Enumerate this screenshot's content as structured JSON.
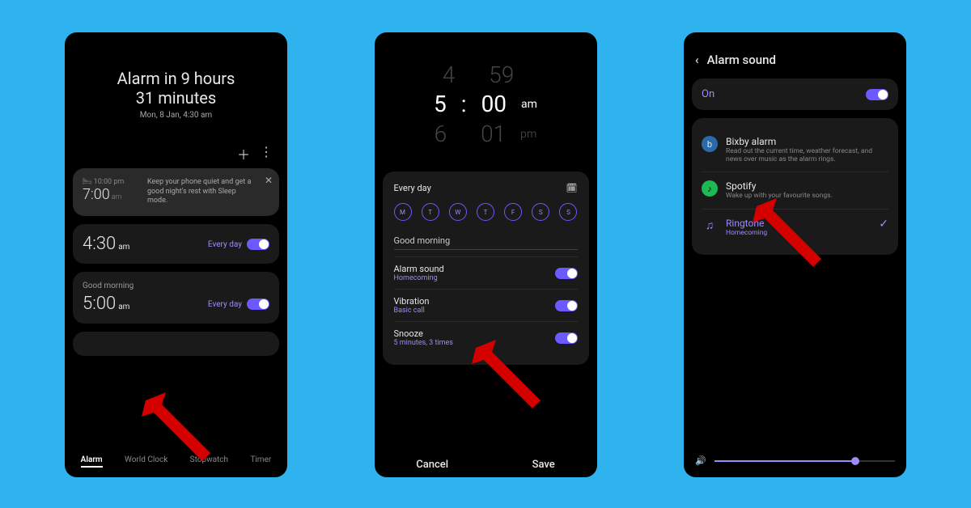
{
  "phone1": {
    "hero_line1": "Alarm in 9 hours",
    "hero_line2": "31 minutes",
    "hero_sub": "Mon, 8 Jan, 4:30 am",
    "sleep": {
      "bedtime": "10:00 pm",
      "wake_time": "7:00",
      "wake_suffix": "am",
      "tip": "Keep your phone quiet and get a good night's rest with Sleep mode."
    },
    "alarm_a": {
      "time": "4:30",
      "suffix": "am",
      "repeat": "Every day"
    },
    "alarm_b": {
      "name": "Good morning",
      "time": "5:00",
      "suffix": "am",
      "repeat": "Every day"
    },
    "tabs": {
      "alarm": "Alarm",
      "world": "World Clock",
      "stop": "Stopwatch",
      "timer": "Timer"
    }
  },
  "phone2": {
    "picker": {
      "h_prev": "4",
      "h": "5",
      "h_next": "6",
      "m_prev": "59",
      "m": "00",
      "m_next": "01",
      "am": "am",
      "pm": "pm"
    },
    "everyday": "Every day",
    "days": [
      "M",
      "T",
      "W",
      "T",
      "F",
      "S",
      "S"
    ],
    "alarm_name": "Good morning",
    "options": {
      "sound": {
        "label": "Alarm sound",
        "value": "Homecoming"
      },
      "vibration": {
        "label": "Vibration",
        "value": "Basic call"
      },
      "snooze": {
        "label": "Snooze",
        "value": "5 minutes, 3 times"
      }
    },
    "cancel": "Cancel",
    "save": "Save"
  },
  "phone3": {
    "title": "Alarm sound",
    "on": "On",
    "bixby": {
      "title": "Bixby alarm",
      "desc": "Read out the current time, weather forecast, and news over music as the alarm rings."
    },
    "spotify": {
      "title": "Spotify",
      "desc": "Wake up with your favourite songs."
    },
    "ringtone": {
      "title": "Ringtone",
      "desc": "Homecoming"
    }
  }
}
